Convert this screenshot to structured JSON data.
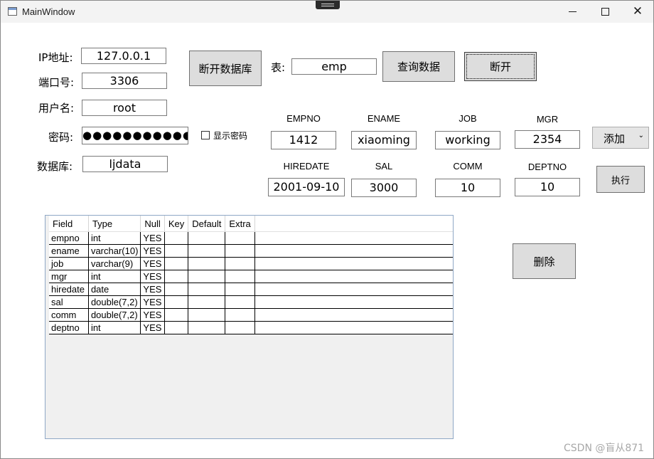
{
  "window": {
    "title": "MainWindow",
    "minimize": "–",
    "close": "✕"
  },
  "connection": {
    "ip_label": "IP地址:",
    "ip_value": "127.0.0.1",
    "port_label": "端口号:",
    "port_value": "3306",
    "user_label": "用户名:",
    "user_value": "root",
    "password_label": "密码:",
    "password_value": "●●●●●●●●●●●",
    "show_password_label": "显示密码",
    "db_label": "数据库:",
    "db_value": "ljdata"
  },
  "toolbar": {
    "disconnect_db_label": "断开数据库",
    "table_label": "表:",
    "table_value": "emp",
    "query_label": "查询数据",
    "disconnect_label": "断开"
  },
  "form": {
    "columns": [
      {
        "label": "EMPNO",
        "value": "1412"
      },
      {
        "label": "ENAME",
        "value": "xiaoming"
      },
      {
        "label": "JOB",
        "value": "working"
      },
      {
        "label": "MGR",
        "value": "2354"
      },
      {
        "label": "HIREDATE",
        "value": "2001-09-10"
      },
      {
        "label": "SAL",
        "value": "3000"
      },
      {
        "label": "COMM",
        "value": "10"
      },
      {
        "label": "DEPTNO",
        "value": "10"
      }
    ],
    "action_selected": "添加",
    "execute_label": "执行",
    "delete_label": "删除"
  },
  "table": {
    "headers": [
      "Field",
      "Type",
      "Null",
      "Key",
      "Default",
      "Extra"
    ],
    "rows": [
      [
        "empno",
        "int",
        "YES",
        "",
        "",
        ""
      ],
      [
        "ename",
        "varchar(10)",
        "YES",
        "",
        "",
        ""
      ],
      [
        "job",
        "varchar(9)",
        "YES",
        "",
        "",
        ""
      ],
      [
        "mgr",
        "int",
        "YES",
        "",
        "",
        ""
      ],
      [
        "hiredate",
        "date",
        "YES",
        "",
        "",
        ""
      ],
      [
        "sal",
        "double(7,2)",
        "YES",
        "",
        "",
        ""
      ],
      [
        "comm",
        "double(7,2)",
        "YES",
        "",
        "",
        ""
      ],
      [
        "deptno",
        "int",
        "YES",
        "",
        "",
        ""
      ]
    ]
  },
  "watermark": "CSDN @盲从871"
}
